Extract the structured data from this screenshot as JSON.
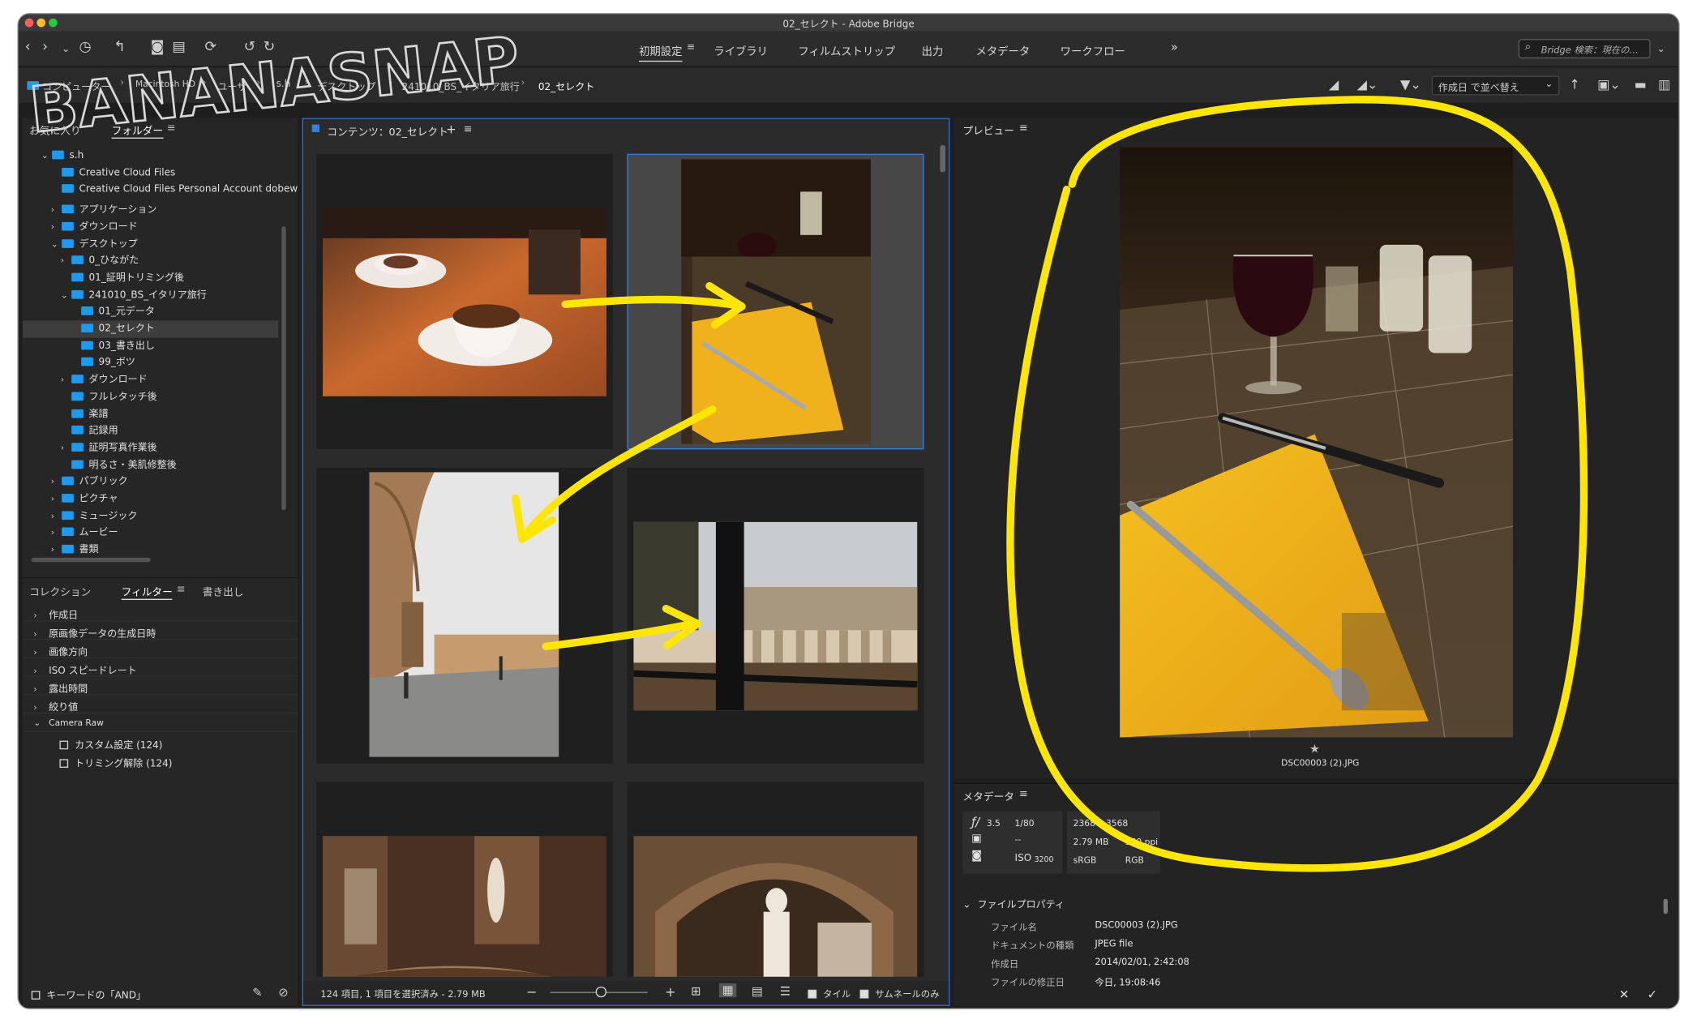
{
  "window": {
    "title": "02_セレクト - Adobe Bridge"
  },
  "toolbar": {
    "workspaces": [
      {
        "label": "初期設定",
        "active": true
      },
      {
        "label": "ライブラリ"
      },
      {
        "label": "フィルムストリップ"
      },
      {
        "label": "出力"
      },
      {
        "label": "メタデータ"
      },
      {
        "label": "ワークフロー"
      }
    ],
    "more": "»",
    "search_placeholder": "Bridge 検索：現在の…"
  },
  "breadcrumb": [
    "コンピューター",
    "Macintosh HD",
    "ユーザ",
    "s.h",
    "デスクトップ",
    "241010_BS_イタリア旅行",
    "02_セレクト"
  ],
  "sort_label": "作成日 で並べ替え",
  "watermark": "BANANASNAP",
  "left_panel": {
    "tabs": [
      "お気に入り",
      "フォルダー"
    ],
    "tree": [
      {
        "label": "s.h",
        "depth": 1,
        "arrow": "down"
      },
      {
        "label": "Creative Cloud Files",
        "depth": 2,
        "arrow": ""
      },
      {
        "label": "Creative Cloud Files Personal Account dobew",
        "depth": 2,
        "arrow": ""
      },
      {
        "label": "アプリケーション",
        "depth": 2,
        "arrow": "right"
      },
      {
        "label": "ダウンロード",
        "depth": 2,
        "arrow": "right"
      },
      {
        "label": "デスクトップ",
        "depth": 2,
        "arrow": "down"
      },
      {
        "label": "0_ひながた",
        "depth": 3,
        "arrow": "right"
      },
      {
        "label": "01_証明トリミング後",
        "depth": 3,
        "arrow": ""
      },
      {
        "label": "241010_BS_イタリア旅行",
        "depth": 3,
        "arrow": "down"
      },
      {
        "label": "01_元データ",
        "depth": 4,
        "arrow": ""
      },
      {
        "label": "02_セレクト",
        "depth": 4,
        "arrow": "",
        "selected": true
      },
      {
        "label": "03_書き出し",
        "depth": 4,
        "arrow": ""
      },
      {
        "label": "99_ボツ",
        "depth": 4,
        "arrow": ""
      },
      {
        "label": "ダウンロード",
        "depth": 3,
        "arrow": "right"
      },
      {
        "label": "フルレタッチ後",
        "depth": 3,
        "arrow": ""
      },
      {
        "label": "楽譜",
        "depth": 3,
        "arrow": ""
      },
      {
        "label": "記録用",
        "depth": 3,
        "arrow": ""
      },
      {
        "label": "証明写真作業後",
        "depth": 3,
        "arrow": "right"
      },
      {
        "label": "明るさ・美肌修整後",
        "depth": 3,
        "arrow": ""
      },
      {
        "label": "パブリック",
        "depth": 2,
        "arrow": "right"
      },
      {
        "label": "ピクチャ",
        "depth": 2,
        "arrow": "right"
      },
      {
        "label": "ミュージック",
        "depth": 2,
        "arrow": "right"
      },
      {
        "label": "ムービー",
        "depth": 2,
        "arrow": "right"
      },
      {
        "label": "書類",
        "depth": 2,
        "arrow": "right"
      }
    ]
  },
  "filter_panel": {
    "tabs": [
      "コレクション",
      "フィルター",
      "書き出し"
    ],
    "rows": [
      "作成日",
      "原画像データの生成日時",
      "画像方向",
      "ISO スピードレート",
      "露出時間",
      "絞り値",
      "Camera Raw"
    ],
    "sub_rows": [
      "カスタム設定 (124)",
      "トリミング解除 (124)"
    ],
    "keyword_label": "キーワードの「AND」"
  },
  "content": {
    "title": "コンテンツ：02_セレクト",
    "status": "124 項目, 1 項目を選択済み - 2.79 MB",
    "tile_label": "タイル",
    "thumbnail_only_label": "サムネールのみ"
  },
  "preview": {
    "title": "プレビュー",
    "rating": "★",
    "filename": "DSC00003 (2).JPG"
  },
  "metadata": {
    "title": "メタデータ",
    "aperture": "3.5",
    "shutter": "1/80",
    "metering": "--",
    "iso_label": "ISO",
    "iso": "3200",
    "dimensions": "2368 x 3568",
    "size": "2.79 MB",
    "ppi": "350 ppi",
    "colorspace": "sRGB",
    "mode": "RGB",
    "section": "ファイルプロパティ",
    "props": [
      {
        "k": "ファイル名",
        "v": "DSC00003 (2).JPG"
      },
      {
        "k": "ドキュメントの種類",
        "v": "JPEG file"
      },
      {
        "k": "作成日",
        "v": "2014/02/01, 2:42:08"
      },
      {
        "k": "ファイルの修正日",
        "v": "今日, 19:08:46"
      }
    ]
  },
  "colors": {
    "accent": "#2f80ed",
    "annotation": "#ffe600",
    "folder": "#1e9bf0"
  }
}
